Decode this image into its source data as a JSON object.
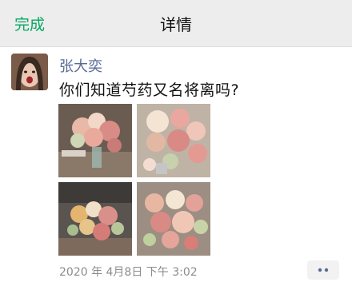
{
  "navbar": {
    "done_label": "完成",
    "title": "详情"
  },
  "post": {
    "author": "张大奕",
    "text": "你们知道芍药又名将离吗?",
    "timestamp": "2020 年 4月8日  下午 3:02",
    "photo_count": 4
  },
  "icons": {
    "more": "more-dots-icon"
  },
  "colors": {
    "accent_green": "#07a861",
    "author_blue": "#576b95"
  }
}
